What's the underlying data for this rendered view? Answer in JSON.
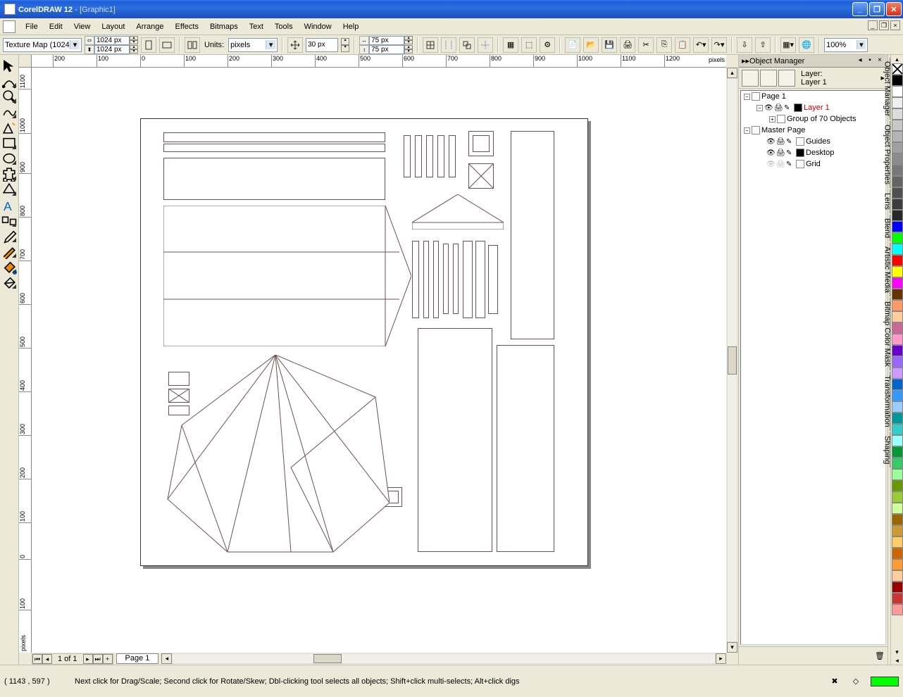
{
  "title": {
    "app": "CorelDRAW 12",
    "doc": "[Graphic1]"
  },
  "menus": [
    "File",
    "Edit",
    "View",
    "Layout",
    "Arrange",
    "Effects",
    "Bitmaps",
    "Text",
    "Tools",
    "Window",
    "Help"
  ],
  "propbar": {
    "preset": "Texture Map (1024...",
    "width": "1024 px",
    "height": "1024 px",
    "units_label": "Units:",
    "units_value": "pixels",
    "nudge": "30 px",
    "dupx": "75 px",
    "dupy": "75 px",
    "zoom": "100%"
  },
  "ruler_unit": "pixels",
  "pagebar": {
    "count": "1 of 1",
    "tab": "Page 1"
  },
  "objmgr": {
    "title": "Object Manager",
    "layer_label": "Layer:",
    "layer_name": "Layer 1",
    "tree": {
      "page": "Page 1",
      "layer": "Layer 1",
      "group": "Group of 70 Objects",
      "master": "Master Page",
      "guides": "Guides",
      "desktop": "Desktop",
      "grid": "Grid"
    }
  },
  "dock_tabs": [
    "Object Manager",
    "Object Properties",
    "Lens",
    "Blend",
    "Artistic Media",
    "Bitmap Color Mask",
    "Transformation",
    "Shaping"
  ],
  "palette": [
    "#000000",
    "#ffffff",
    "#efefef",
    "#dcdcdc",
    "#c8c8c8",
    "#b4b4b4",
    "#a0a0a0",
    "#8c8c8c",
    "#787878",
    "#646464",
    "#505050",
    "#3c3c3c",
    "#282828",
    "#0000ff",
    "#00ff00",
    "#00ffff",
    "#ff0000",
    "#ffff00",
    "#ff00ff",
    "#663300",
    "#ff9966",
    "#ffcc99",
    "#cc6699",
    "#ff99cc",
    "#6600cc",
    "#9966ff",
    "#cc99ff",
    "#0066cc",
    "#3399ff",
    "#99ccff",
    "#009999",
    "#33cccc",
    "#99ffff",
    "#009933",
    "#33cc66",
    "#99ff99",
    "#669900",
    "#99cc33",
    "#ccff99",
    "#996600",
    "#cc9933",
    "#ffcc66",
    "#cc6600",
    "#ff9933",
    "#ffcc99",
    "#990000",
    "#cc3333",
    "#ff9999"
  ],
  "status": {
    "coords": "( 1143 , 597   )",
    "hint": "Next click for Drag/Scale; Second click for Rotate/Skew; Dbl-clicking tool selects all objects; Shift+click multi-selects; Alt+click digs"
  },
  "hruler": [
    {
      "v": "200",
      "p": 30
    },
    {
      "v": "100",
      "p": 92
    },
    {
      "v": "0",
      "p": 154
    },
    {
      "v": "100",
      "p": 216
    },
    {
      "v": "200",
      "p": 278
    },
    {
      "v": "300",
      "p": 340
    },
    {
      "v": "400",
      "p": 402
    },
    {
      "v": "500",
      "p": 464
    },
    {
      "v": "600",
      "p": 526
    },
    {
      "v": "700",
      "p": 588
    },
    {
      "v": "800",
      "p": 650
    },
    {
      "v": "900",
      "p": 712
    },
    {
      "v": "1000",
      "p": 774
    },
    {
      "v": "1100",
      "p": 836
    },
    {
      "v": "1200",
      "p": 898
    }
  ],
  "vruler": [
    {
      "v": "1100",
      "p": 10
    },
    {
      "v": "1000",
      "p": 72
    },
    {
      "v": "900",
      "p": 134
    },
    {
      "v": "800",
      "p": 196
    },
    {
      "v": "700",
      "p": 258
    },
    {
      "v": "600",
      "p": 320
    },
    {
      "v": "500",
      "p": 382
    },
    {
      "v": "400",
      "p": 444
    },
    {
      "v": "300",
      "p": 506
    },
    {
      "v": "200",
      "p": 568
    },
    {
      "v": "100",
      "p": 630
    },
    {
      "v": "0",
      "p": 692
    },
    {
      "v": "100",
      "p": 754
    }
  ]
}
